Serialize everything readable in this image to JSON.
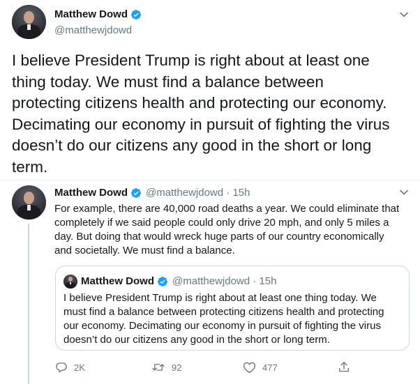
{
  "main_tweet": {
    "author_name": "Matthew Dowd",
    "author_handle": "@matthewjdowd",
    "text": "I believe President Trump is right about at least one\nthing today.  We must find a balance between\nprotecting citizens health and protecting our economy.\nDecimating our economy in pursuit of fighting the virus\ndoesn’t do our citizens any good in the short or long\nterm."
  },
  "reply_tweet": {
    "author_name": "Matthew Dowd",
    "meta": "@matthewjdowd · 15h",
    "text": "For example, there are 40,000 road deaths a year.  We could eliminate that\ncompletely if we said people could only drive 20 mph, and only 5 miles a\nday.  But doing that would wreck huge parts of our country economically\nand societally.  We must find a balance.",
    "quoted": {
      "author_name": "Matthew Dowd",
      "meta": "@matthewjdowd · 15h",
      "text": "I believe President Trump is right about at least one thing today.  We\nmust find a balance between protecting citizens health and protecting\nour economy.  Decimating our economy in pursuit of fighting the virus\ndoesn’t do our citizens any good in the short or long term."
    },
    "actions": {
      "replies": "2K",
      "retweets": "92",
      "likes": "477"
    }
  },
  "colors": {
    "verified_blue": "#1da1f2",
    "secondary_text": "#657786",
    "border": "#ccd6dd"
  },
  "icons": [
    "verified-badge-icon",
    "chevron-down-icon",
    "reply-icon",
    "retweet-icon",
    "like-icon",
    "share-icon"
  ]
}
